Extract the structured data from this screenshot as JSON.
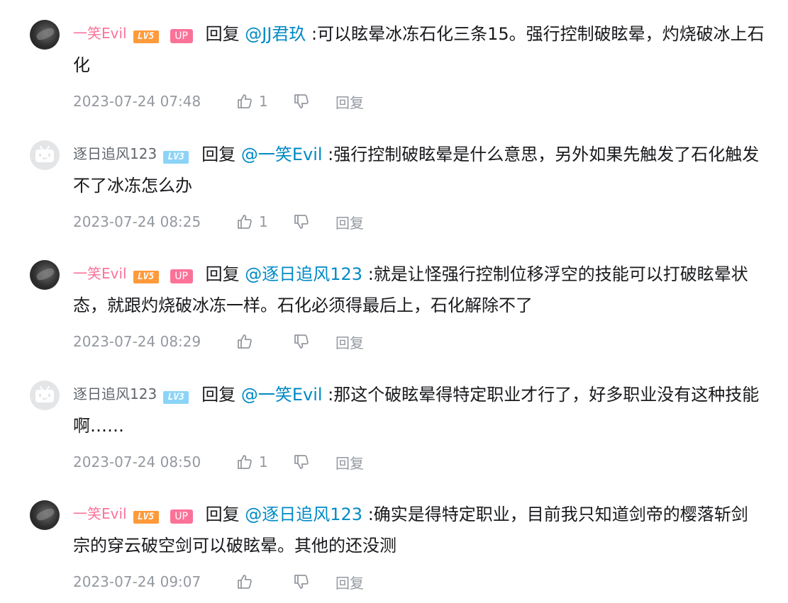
{
  "labels": {
    "reply_word": "回复",
    "reply_button": "回复",
    "up_badge": "UP"
  },
  "level_badges": {
    "lv5": "LV5",
    "lv3": "LV3"
  },
  "colors": {
    "name_pink": "#fb7299",
    "mention_blue": "#008ac5",
    "meta_gray": "#9499a0",
    "lv5": "#ff9a3a",
    "lv3": "#8bd4f7"
  },
  "replies": [
    {
      "user": "一笑Evil",
      "avatar": "photo-avatar",
      "level": "LV5",
      "is_up": true,
      "mention": "@JJ君玖",
      "content": ":可以眩晕冰冻石化三条15。强行控制破眩晕，灼烧破冰上石化",
      "time": "2023-07-24 07:48",
      "likes": "1"
    },
    {
      "user": "逐日追风123",
      "avatar": "tv-avatar",
      "level": "LV3",
      "is_up": false,
      "mention": "@一笑Evil",
      "content": ":强行控制破眩晕是什么意思，另外如果先触发了石化触发不了冰冻怎么办",
      "time": "2023-07-24 08:25",
      "likes": "1"
    },
    {
      "user": "一笑Evil",
      "avatar": "photo-avatar",
      "level": "LV5",
      "is_up": true,
      "mention": "@逐日追风123",
      "content": ":就是让怪强行控制位移浮空的技能可以打破眩晕状态，就跟灼烧破冰冻一样。石化必须得最后上，石化解除不了",
      "time": "2023-07-24 08:29",
      "likes": ""
    },
    {
      "user": "逐日追风123",
      "avatar": "tv-avatar",
      "level": "LV3",
      "is_up": false,
      "mention": "@一笑Evil",
      "content": ":那这个破眩晕得特定职业才行了，好多职业没有这种技能啊……",
      "time": "2023-07-24 08:50",
      "likes": "1"
    },
    {
      "user": "一笑Evil",
      "avatar": "photo-avatar",
      "level": "LV5",
      "is_up": true,
      "mention": "@逐日追风123",
      "content": ":确实是得特定职业，目前我只知道剑帝的樱落斩剑宗的穿云破空剑可以破眩晕。其他的还没测",
      "time": "2023-07-24 09:07",
      "likes": ""
    }
  ]
}
